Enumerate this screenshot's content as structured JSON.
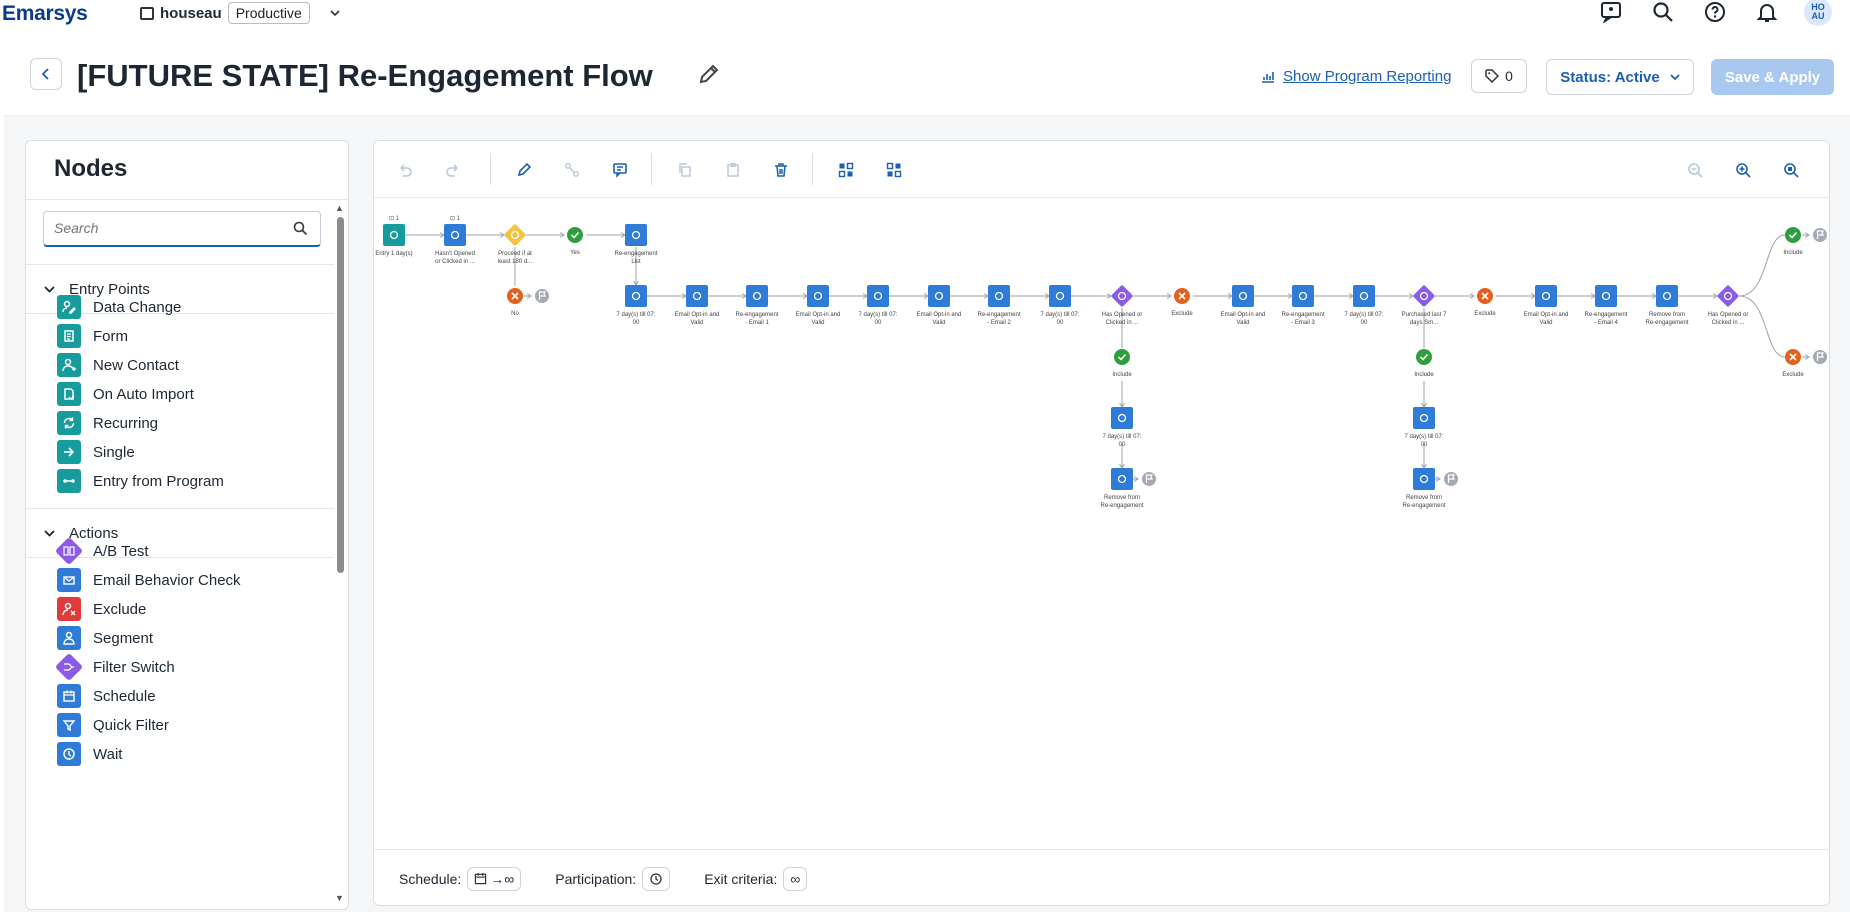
{
  "topbar": {
    "brand": "Emarsys",
    "tenant_name": "houseau",
    "environment": "Productive",
    "avatar_initials_top": "HO",
    "avatar_initials_bottom": "AU"
  },
  "header": {
    "title": "[FUTURE STATE] Re-Engagement Flow",
    "report_link": "Show Program Reporting",
    "tag_count": "0",
    "status_label": "Status: Active",
    "save_label": "Save & Apply"
  },
  "nodes_panel": {
    "title": "Nodes",
    "search_placeholder": "Search",
    "sections": [
      {
        "label": "Entry Points",
        "items": [
          {
            "label": "Data Change",
            "icon": "data-change-icon"
          },
          {
            "label": "Form",
            "icon": "form-icon"
          },
          {
            "label": "New Contact",
            "icon": "new-contact-icon"
          },
          {
            "label": "On Auto Import",
            "icon": "auto-import-icon"
          },
          {
            "label": "Recurring",
            "icon": "recurring-icon"
          },
          {
            "label": "Single",
            "icon": "single-icon"
          },
          {
            "label": "Entry from Program",
            "icon": "entry-program-icon"
          }
        ]
      },
      {
        "label": "Actions",
        "items": [
          {
            "label": "A/B Test",
            "icon": "ab-test-icon"
          },
          {
            "label": "Email Behavior Check",
            "icon": "email-behavior-icon"
          },
          {
            "label": "Exclude",
            "icon": "exclude-icon"
          },
          {
            "label": "Segment",
            "icon": "segment-icon"
          },
          {
            "label": "Filter Switch",
            "icon": "filter-switch-icon"
          },
          {
            "label": "Schedule",
            "icon": "schedule-icon"
          },
          {
            "label": "Quick Filter",
            "icon": "quick-filter-icon"
          },
          {
            "label": "Wait",
            "icon": "wait-icon"
          }
        ]
      }
    ]
  },
  "colors": {
    "teal": "#169c9c",
    "blue": "#2f7cd8",
    "red": "#e03a3a",
    "purple": "#8b5be8",
    "yellow": "#f5c242",
    "green": "#2e9e3f",
    "orange": "#e5601d",
    "grey": "#a3aab4"
  },
  "flow": {
    "nodes": [
      {
        "id": "n1",
        "type": "teal",
        "label1": "Entry 1 day(s)",
        "label2": "",
        "badge": "1"
      },
      {
        "id": "n2",
        "type": "blue",
        "label1": "Hasn't Opened",
        "label2": "or Clicked in ...",
        "badge": "1"
      },
      {
        "id": "n3",
        "type": "yellow",
        "label1": "Proceed if at",
        "label2": "least 180 d..."
      },
      {
        "id": "n4",
        "type": "green",
        "label1": "Yes",
        "label2": ""
      },
      {
        "id": "n5",
        "type": "blue",
        "label1": "Re-engagement",
        "label2": "List"
      },
      {
        "id": "n6",
        "type": "orange",
        "label1": "No",
        "label2": ""
      },
      {
        "id": "m1",
        "type": "blue",
        "label1": "7 day(s) till 07:",
        "label2": "00"
      },
      {
        "id": "m2",
        "type": "blue",
        "label1": "Email Opt-in and",
        "label2": "Valid"
      },
      {
        "id": "m3",
        "type": "blue",
        "label1": "Re-engagement",
        "label2": "- Email 1"
      },
      {
        "id": "m4",
        "type": "blue",
        "label1": "Email Opt-in and",
        "label2": "Valid"
      },
      {
        "id": "m5",
        "type": "blue",
        "label1": "7 day(s) till 07:",
        "label2": "00"
      },
      {
        "id": "m6",
        "type": "blue",
        "label1": "Email Opt-in and",
        "label2": "Valid"
      },
      {
        "id": "m7",
        "type": "blue",
        "label1": "Re-engagement",
        "label2": "- Email 2"
      },
      {
        "id": "m8",
        "type": "blue",
        "label1": "7 day(s) till 07:",
        "label2": "00"
      },
      {
        "id": "m9",
        "type": "purple",
        "label1": "Has Opened or",
        "label2": "Clicked in ..."
      },
      {
        "id": "m10",
        "type": "orange",
        "label1": "Exclude",
        "label2": ""
      },
      {
        "id": "m11",
        "type": "blue",
        "label1": "Email Opt-in and",
        "label2": "Valid"
      },
      {
        "id": "m12",
        "type": "blue",
        "label1": "Re-engagement",
        "label2": "- Email 3"
      },
      {
        "id": "m13",
        "type": "blue",
        "label1": "7 day(s) till 07:",
        "label2": "00"
      },
      {
        "id": "m14",
        "type": "purple",
        "label1": "Purchased last 7",
        "label2": "days Sm..."
      },
      {
        "id": "m15",
        "type": "orange",
        "label1": "Exclude",
        "label2": ""
      },
      {
        "id": "m16",
        "type": "blue",
        "label1": "Email Opt-in and",
        "label2": "Valid"
      },
      {
        "id": "m17",
        "type": "blue",
        "label1": "Re-engagement",
        "label2": "- Email 4"
      },
      {
        "id": "m18",
        "type": "blue",
        "label1": "Remove from",
        "label2": "Re-engagement"
      },
      {
        "id": "m19",
        "type": "purple",
        "label1": "Has Opened or",
        "label2": "Clicked in ..."
      },
      {
        "id": "b1",
        "type": "green",
        "label1": "Include",
        "label2": ""
      },
      {
        "id": "b2",
        "type": "blue",
        "label1": "7 day(s) till 07:",
        "label2": "00"
      },
      {
        "id": "b3",
        "type": "blue",
        "label1": "Remove from",
        "label2": "Re-engagement"
      },
      {
        "id": "c1",
        "type": "green",
        "label1": "Include",
        "label2": ""
      },
      {
        "id": "c2",
        "type": "blue",
        "label1": "7 day(s) till 07:",
        "label2": "00"
      },
      {
        "id": "c3",
        "type": "blue",
        "label1": "Remove from",
        "label2": "Re-engagement"
      },
      {
        "id": "e1",
        "type": "green",
        "label1": "Include",
        "label2": ""
      },
      {
        "id": "e2",
        "type": "orange",
        "label1": "Exclude",
        "label2": ""
      }
    ]
  },
  "footer": {
    "schedule_label": "Schedule:",
    "participation_label": "Participation:",
    "exit_label": "Exit criteria:"
  }
}
